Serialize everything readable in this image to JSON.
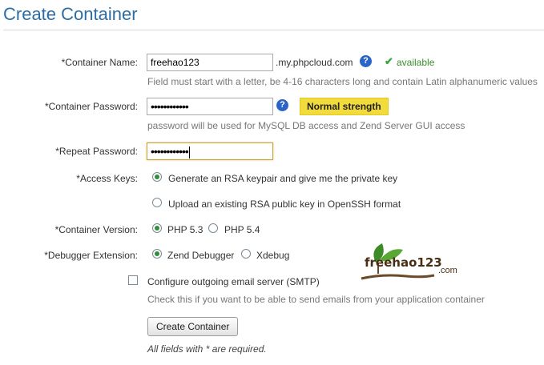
{
  "page": {
    "title": "Create Container"
  },
  "form": {
    "container_name": {
      "label": "*Container Name:",
      "value": "freehao123",
      "suffix": ".my.phpcloud.com",
      "status": "available",
      "help": "Field must start with a letter, be 4-16 characters long and contain Latin alphanumeric values"
    },
    "container_password": {
      "label": "*Container Password:",
      "value": "••••••••••••",
      "strength": "Normal strength",
      "help": "password will be used for MySQL DB access and Zend Server GUI access"
    },
    "repeat_password": {
      "label": "*Repeat Password:",
      "value": "••••••••••••"
    },
    "access_keys": {
      "label": "*Access Keys:",
      "options": [
        {
          "label": "Generate an RSA keypair and give me the private key",
          "selected": true
        },
        {
          "label": "Upload an existing RSA public key in OpenSSH format",
          "selected": false
        }
      ]
    },
    "container_version": {
      "label": "*Container Version:",
      "options": [
        {
          "label": "PHP 5.3",
          "selected": true
        },
        {
          "label": "PHP 5.4",
          "selected": false
        }
      ]
    },
    "debugger_extension": {
      "label": "*Debugger Extension:",
      "options": [
        {
          "label": "Zend Debugger",
          "selected": true
        },
        {
          "label": "Xdebug",
          "selected": false
        }
      ]
    },
    "smtp": {
      "label": "Configure outgoing email server (SMTP)",
      "checked": false,
      "help": "Check this if you want to be able to send emails from your application container"
    },
    "submit_label": "Create Container",
    "required_note": "All fields with * are required."
  },
  "watermark": {
    "text": "freehao123",
    "suffix": ".com"
  },
  "icons": {
    "help": "question-icon",
    "available": "checkmark-icon"
  },
  "colors": {
    "title": "#2e6da4",
    "strength": "#f2dc3c",
    "available": "#3b8e2d",
    "radio_selected": "#2f8f3f"
  }
}
